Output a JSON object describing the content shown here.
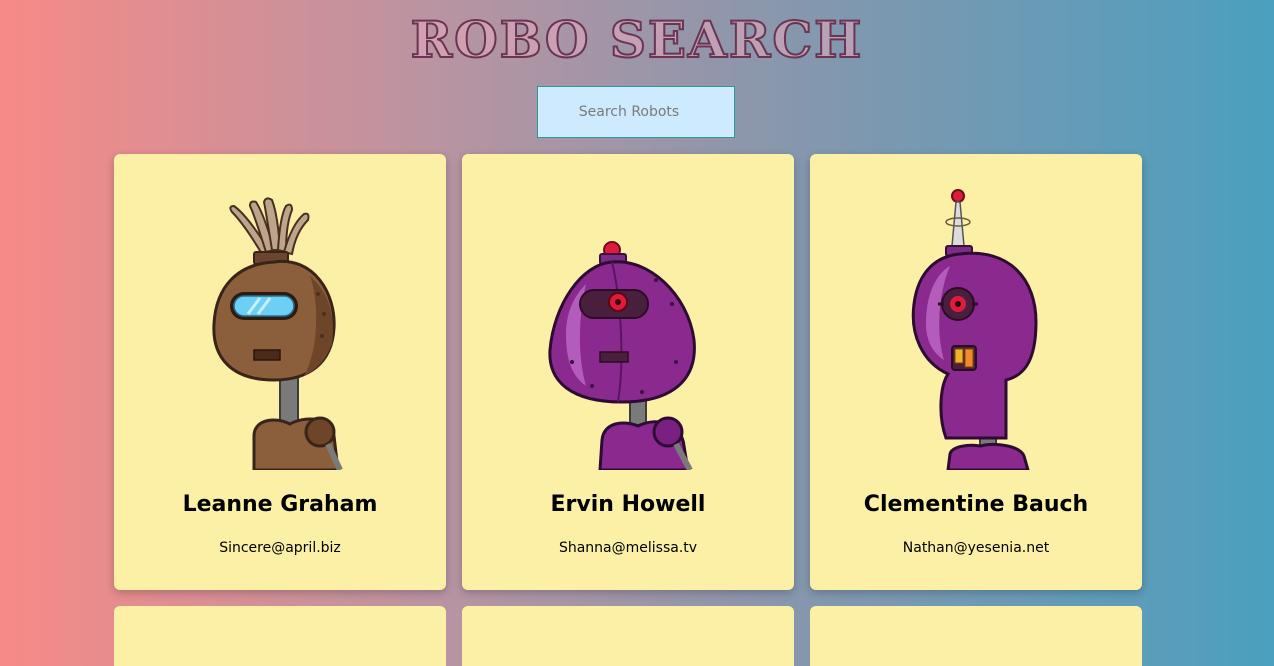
{
  "header": {
    "title": "ROBO SEARCH"
  },
  "search": {
    "placeholder": "Search Robots"
  },
  "robots": [
    {
      "name": "Leanne Graham",
      "email": "Sincere@april.biz"
    },
    {
      "name": "Ervin Howell",
      "email": "Shanna@melissa.tv"
    },
    {
      "name": "Clementine Bauch",
      "email": "Nathan@yesenia.net"
    }
  ],
  "colors": {
    "card_bg": "#fbf0a5",
    "search_bg": "#cdeafe",
    "search_border": "#2a9d8f",
    "gradient_left": "#f78a87",
    "gradient_right": "#4b9fbf"
  }
}
